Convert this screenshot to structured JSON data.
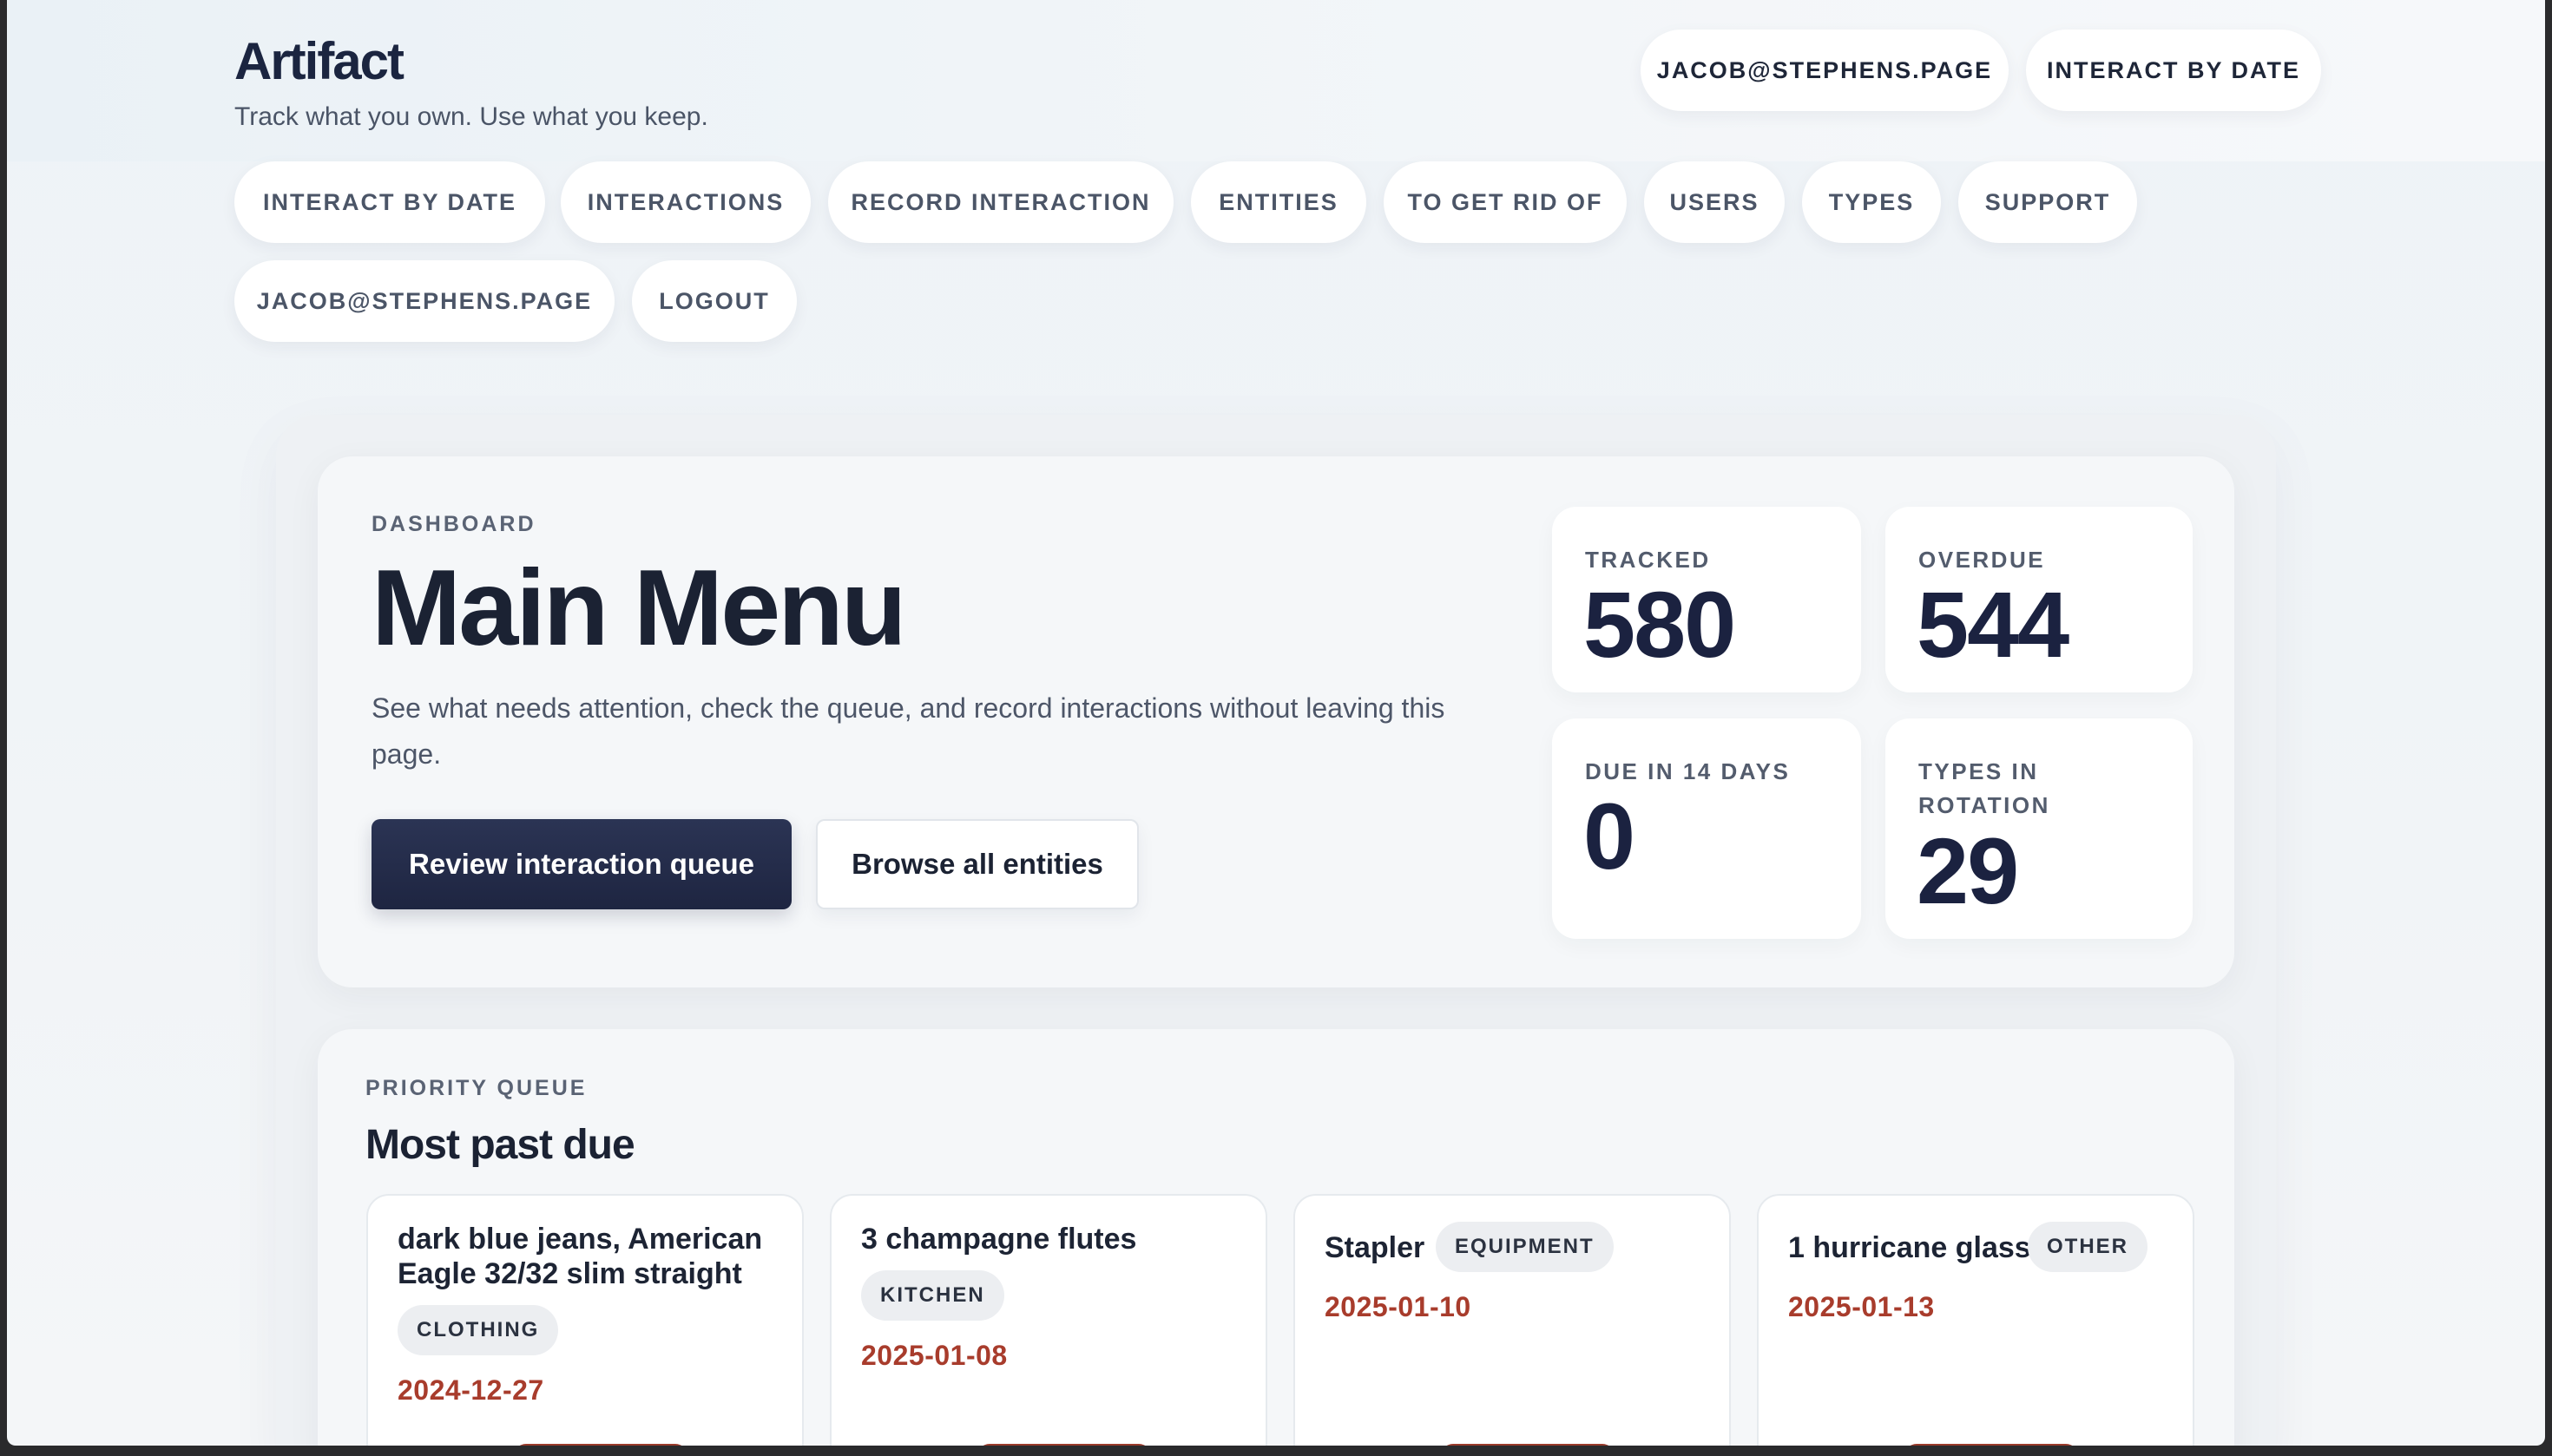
{
  "header": {
    "brand": "Artifact",
    "tagline": "Track what you own. Use what you keep.",
    "top_user": "JACOB@STEPHENS.PAGE",
    "top_interact": "INTERACT BY DATE"
  },
  "nav": {
    "items": [
      {
        "label": "INTERACT BY DATE"
      },
      {
        "label": "INTERACTIONS"
      },
      {
        "label": "RECORD INTERACTION"
      },
      {
        "label": "ENTITIES"
      },
      {
        "label": "TO GET RID OF"
      },
      {
        "label": "USERS"
      },
      {
        "label": "TYPES"
      },
      {
        "label": "SUPPORT"
      },
      {
        "label": "JACOB@STEPHENS.PAGE"
      },
      {
        "label": "LOGOUT"
      }
    ]
  },
  "hero": {
    "eyebrow": "DASHBOARD",
    "title": "Main Menu",
    "description": "See what needs attention, check the queue, and record interactions without leaving this page.",
    "primary_button": "Review interaction queue",
    "secondary_button": "Browse all entities"
  },
  "stats": [
    {
      "label": "TRACKED",
      "value": "580"
    },
    {
      "label": "OVERDUE",
      "value": "544"
    },
    {
      "label": "DUE IN 14 DAYS",
      "value": "0"
    },
    {
      "label": "TYPES IN ROTATION",
      "value": "29"
    }
  ],
  "queue": {
    "eyebrow": "PRIORITY QUEUE",
    "title": "Most past due",
    "items": [
      {
        "name": "dark blue jeans, American Eagle 32/32 slim straight",
        "type": "CLOTHING",
        "due": "2024-12-27"
      },
      {
        "name": "3 champagne flutes",
        "type": "KITCHEN",
        "due": "2025-01-08"
      },
      {
        "name": "Stapler",
        "type": "EQUIPMENT",
        "due": "2025-01-10"
      },
      {
        "name": "1 hurricane glass",
        "type": "OTHER",
        "due": "2025-01-13"
      }
    ]
  },
  "colors": {
    "brand_navy": "#1e2541",
    "overdue_red": "#a83c2c",
    "action_red": "#9a3a2a"
  }
}
